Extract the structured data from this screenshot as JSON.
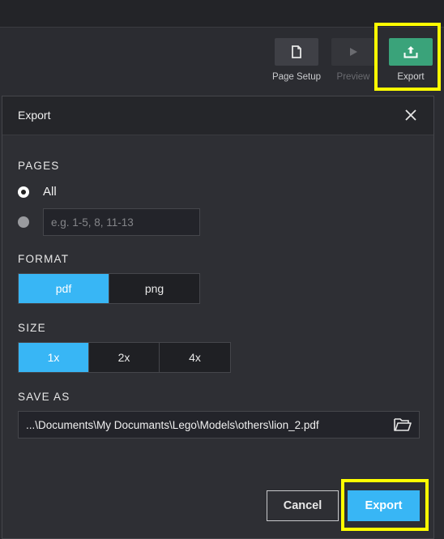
{
  "toolbar": {
    "page_setup_label": "Page Setup",
    "preview_label": "Preview",
    "export_label": "Export"
  },
  "dialog": {
    "title": "Export",
    "pages": {
      "label": "PAGES",
      "all_label": "All",
      "all_selected": true,
      "range_placeholder": "e.g. 1-5, 8, 11-13",
      "range_value": ""
    },
    "format": {
      "label": "FORMAT",
      "options": [
        "pdf",
        "png"
      ],
      "selected": "pdf"
    },
    "size": {
      "label": "SIZE",
      "options": [
        "1x",
        "2x",
        "4x"
      ],
      "selected": "1x"
    },
    "save_as": {
      "label": "SAVE AS",
      "path": "...\\Documents\\My Documants\\Lego\\Models\\others\\lion_2.pdf"
    },
    "cancel_label": "Cancel",
    "export_label": "Export"
  },
  "colors": {
    "accent": "#38b6f5",
    "export_tile": "#3aa37a",
    "highlight": "#ffff00",
    "background": "#2b2c31"
  },
  "icons": {
    "page_setup": "page-icon",
    "preview": "play-icon",
    "export": "upload-tray-icon",
    "close": "close-icon",
    "browse": "folder-open-icon"
  }
}
